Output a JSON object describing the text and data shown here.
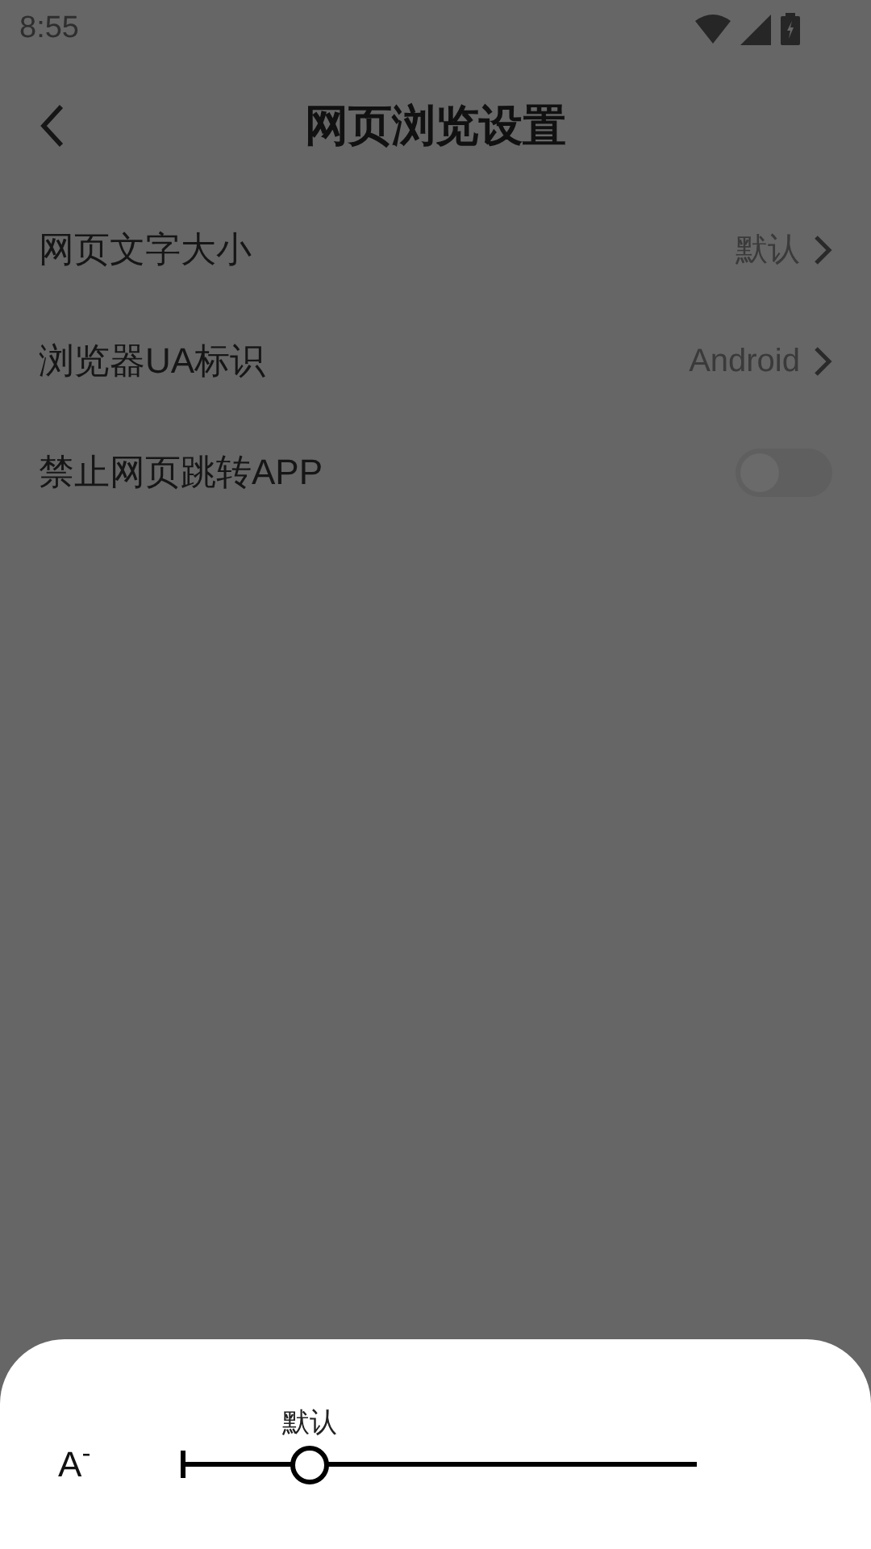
{
  "status_bar": {
    "time": "8:55"
  },
  "header": {
    "title": "网页浏览设置"
  },
  "settings": [
    {
      "kind": "link",
      "label": "网页文字大小",
      "value": "默认"
    },
    {
      "kind": "link",
      "label": "浏览器UA标识",
      "value": "Android"
    },
    {
      "kind": "toggle",
      "label": "禁止网页跳转APP",
      "on": false
    }
  ],
  "font_size_sheet": {
    "small_label": "A$^{-}$",
    "slider_label": "默认",
    "level": 0.25
  }
}
